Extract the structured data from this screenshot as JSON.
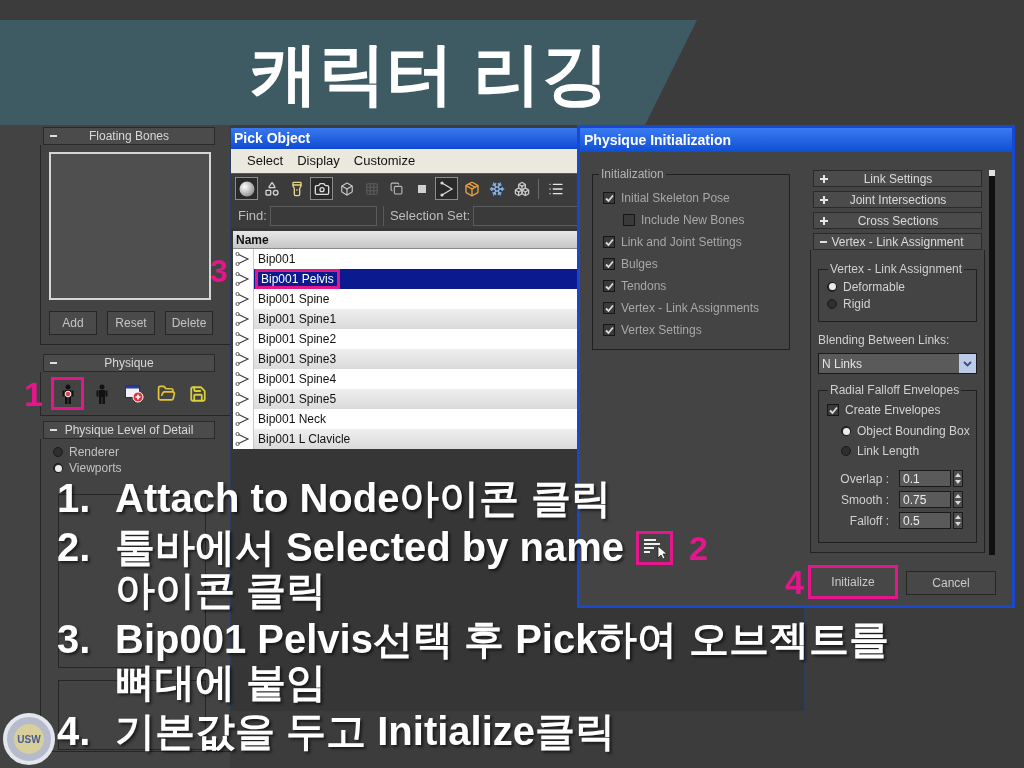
{
  "title": "캐릭터 리깅",
  "command_panel": {
    "rollouts": [
      {
        "kind": "list",
        "title": "Floating Bones",
        "expanded": true,
        "buttons": [
          "Add",
          "Reset",
          "Delete"
        ]
      },
      {
        "kind": "tools",
        "title": "Physique",
        "expanded": true,
        "tools": [
          {
            "kind": "attach",
            "highlighted": true,
            "callout": "1"
          },
          {
            "kind": "figure",
            "highlighted": false
          },
          {
            "kind": "window",
            "highlighted": false
          },
          {
            "kind": "open",
            "highlighted": false
          },
          {
            "kind": "save",
            "highlighted": false
          }
        ]
      },
      {
        "kind": "options",
        "title": "Physique Level of Detail",
        "expanded": true,
        "options": [
          {
            "label": "Renderer",
            "selected": false
          },
          {
            "label": "Viewports",
            "selected": true
          }
        ]
      }
    ]
  },
  "pick_object": {
    "title": "Pick Object",
    "menu": [
      "Select",
      "Display",
      "Customize"
    ],
    "toolbar_groups": [
      [
        {
          "kind": "sphere",
          "pressed": true
        },
        {
          "kind": "shapes",
          "pressed": false
        },
        {
          "kind": "light",
          "pressed": false
        },
        {
          "kind": "camera",
          "pressed": true
        },
        {
          "kind": "helper",
          "pressed": false
        },
        {
          "kind": "warp",
          "pressed": false
        },
        {
          "kind": "group",
          "pressed": false
        },
        {
          "kind": "xref",
          "pressed": false
        },
        {
          "kind": "bone",
          "pressed": true
        },
        {
          "kind": "container",
          "pressed": false
        },
        {
          "kind": "frozen",
          "pressed": false
        },
        {
          "kind": "hidden",
          "pressed": false
        }
      ],
      [
        {
          "kind": "list",
          "pressed": false
        }
      ]
    ],
    "find": {
      "label": "Find:"
    },
    "selection_set": {
      "label": "Selection Set:"
    },
    "column": "Name",
    "rows": [
      {
        "name": "Bip001",
        "selected": false,
        "highlighted": false
      },
      {
        "name": "Bip001 Pelvis",
        "selected": true,
        "highlighted": true,
        "callout": "3"
      },
      {
        "name": "Bip001 Spine",
        "selected": false,
        "highlighted": false
      },
      {
        "name": "Bip001 Spine1",
        "selected": false,
        "highlighted": false
      },
      {
        "name": "Bip001 Spine2",
        "selected": false,
        "highlighted": false
      },
      {
        "name": "Bip001 Spine3",
        "selected": false,
        "highlighted": false
      },
      {
        "name": "Bip001 Spine4",
        "selected": false,
        "highlighted": false
      },
      {
        "name": "Bip001 Spine5",
        "selected": false,
        "highlighted": false
      },
      {
        "name": "Bip001 Neck",
        "selected": false,
        "highlighted": false
      },
      {
        "name": "Bip001 L Clavicle",
        "selected": false,
        "highlighted": false
      }
    ]
  },
  "physique_init": {
    "title": "Physique Initialization",
    "initialization": {
      "legend": "Initialization",
      "options": [
        {
          "label": "Initial Skeleton Pose",
          "checked": true,
          "children": [
            {
              "label": "Include New Bones",
              "checked": false
            }
          ]
        },
        {
          "label": "Link and Joint Settings",
          "checked": true
        },
        {
          "label": "Bulges",
          "checked": true
        },
        {
          "label": "Tendons",
          "checked": true
        },
        {
          "label": "Vertex - Link Assignments",
          "checked": true
        },
        {
          "label": "Vertex Settings",
          "checked": true
        }
      ]
    },
    "rollouts": [
      {
        "title": "Link Settings",
        "expanded": false
      },
      {
        "title": "Joint Intersections",
        "expanded": false
      },
      {
        "title": "Cross Sections",
        "expanded": false
      },
      {
        "title": "Vertex - Link Assignment",
        "expanded": true
      }
    ],
    "vertex_link": {
      "legend": "Vertex - Link Assignment",
      "options": [
        {
          "label": "Deformable",
          "selected": true
        },
        {
          "label": "Rigid",
          "selected": false
        }
      ]
    },
    "blending": {
      "label": "Blending Between Links:",
      "value": "N Links"
    },
    "radial_falloff": {
      "legend": "Radial Falloff Envelopes",
      "create": {
        "label": "Create Envelopes",
        "checked": true
      },
      "options": [
        {
          "label": "Object Bounding Box",
          "selected": true
        },
        {
          "label": "Link Length",
          "selected": false
        }
      ],
      "spinners": [
        {
          "label": "Overlap :",
          "value": "0.1"
        },
        {
          "label": "Smooth :",
          "value": "0.75"
        },
        {
          "label": "Falloff :",
          "value": "0.5"
        }
      ]
    },
    "buttons": [
      {
        "label": "Initialize",
        "highlighted": true,
        "callout": "4"
      },
      {
        "label": "Cancel",
        "highlighted": false
      }
    ]
  },
  "steps": [
    {
      "number": "1.",
      "text": "Attach to Node아이콘 클릭"
    },
    {
      "number": "2.",
      "text": "툴바에서 Selected by name",
      "icon": {
        "highlighted": true,
        "callout": "2"
      },
      "text_after": "아이콘 클릭"
    },
    {
      "number": "3.",
      "text": "Bip001 Pelvis선택 후 Pick하여 오브젝트를 뼈대에 붙임"
    },
    {
      "number": "4.",
      "text": "기본값을 두고 Initialize클릭"
    }
  ],
  "logo": {
    "text": "USW"
  }
}
